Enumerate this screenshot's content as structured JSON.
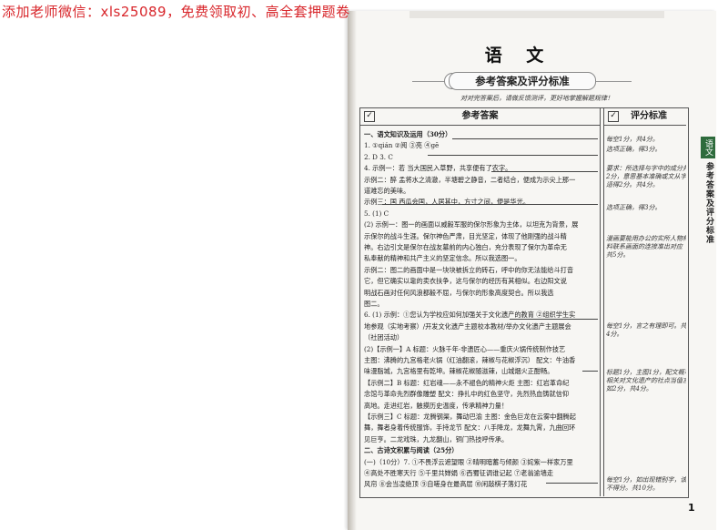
{
  "watermark": "添加老师微信：xls25089，免费领取初、高全套押题卷",
  "top_strip": "",
  "subject": "语 文",
  "banner_title": "参考答案及评分标准",
  "instruction": "对对完答案后，请做反馈测评，更好地掌握解题规律！",
  "header": {
    "answers": "参考答案",
    "standards": "评分标准"
  },
  "answer_lines": [
    {
      "text": "一、语文知识及运用（30分）",
      "bold": true
    },
    {
      "text": "1. ①qián ②阅 ③亮 ④gē"
    },
    {
      "text": "2. D 3. C"
    },
    {
      "text": "4. 示例一：若 当大国民入草野，共享便有了农字。"
    },
    {
      "text": "示例二：醉 孟将水之清澈，半塘碧之静音，二者结合，便成为示尖上那一"
    },
    {
      "text": "道难忘的美味。"
    },
    {
      "text": "示例三：国 西瓜会国，人居其中，方寸之间，便是华光。"
    },
    {
      "text": "5. (1) C"
    },
    {
      "text": "(2) 示例一：图一的画面以威毅军服的保尔形象为主体，以坦克为背景，展"
    },
    {
      "text": "示保尔的战斗生涯。保尔神色严肃，目光坚定，体现了他刚强的战斗精"
    },
    {
      "text": "神。右边引文是保尔在战友墓前的内心独白，充分表现了保尔为革命无"
    },
    {
      "text": "私奉献的精神和共产主义的坚定信念。所以我选图一。"
    },
    {
      "text": "示例二：图二的画面中是一块块被拆立的砖石，呼中的你无法能给斗打音"
    },
    {
      "text": "它，但它确实以靠的卖衣扶争，这与保尔的经历有其相似。右边阳文说"
    },
    {
      "text": "明战石画对任何风浪都毅不屈，与保尔的形象高度契合。所以我选"
    },
    {
      "text": "图二。"
    },
    {
      "text": "6. (1) 示例：①您认为学校应如何加强关于文化遗产的教育 ②组织学生实"
    },
    {
      "text": "地参观（实地考察）/开发文化遗产主题校本教材/举办文化遗产主题展会"
    },
    {
      "text": "（社团活动）"
    },
    {
      "text": "(2)【示例一】A 标题：火脉千年·非遗匠心——重庆火锅传统制作技艺"
    },
    {
      "text": "主图：沸腾的九宫格老火锅（红油翻滚，辣椒与花椒浮沉） 配文：牛油香"
    },
    {
      "text": "味漫脂城，九宫格里有乾坤。辣椒花椒随滋辣，山城烟火正酣畅。"
    },
    {
      "text": "【示例二】B 标题：红岩魂——永不褪色的精神火炬 主图：红岩革命纪"
    },
    {
      "text": "念馆与革命先烈群像雕塑 配文：挣扎中的红色坚守，先烈热血铸就信仰"
    },
    {
      "text": "高地。走进红岩，触摸历史温度，传承精神力量！"
    },
    {
      "text": "【示例三】C 标题：龙腾钢渠，舞动巴渝 主图：金色巨龙在云雾中翻腾起"
    },
    {
      "text": "舞，舞者身着传统服饰，手持龙节 配文：八手降龙，龙舞九霄，九曲回环"
    },
    {
      "text": "见巨亨。二龙戏珠，九龙翻山，铜门热技呼传承。"
    },
    {
      "text": "二、古诗文积累与阅读（25分）",
      "bold": true
    },
    {
      "text": "(一)（10分）7. ①不畏浮云遮望眼 ②晴明暗蓄与倾颜 ③姹紫一样家万里"
    },
    {
      "text": "④高处不胜寒天行 ⑤千里共婵娟 ⑥西蜀征调谁记起 ⑦老翁逾墙走"
    },
    {
      "text": "风帘 ⑧会当凌绝顶 ⑨自嗟身在最高层 ⑩闲敲棋子落灯花"
    }
  ],
  "standard_notes": [
    "每空1分，共4分。",
    "选项正确，得3分。",
    "要求：所选择与字中的成分并且",
    "2分，意思基本准确或文从字顺",
    "适得2分。共4分。",
    "选项正确，得3分。",
    "漫画要能用办公的实所人物材",
    "料联系画面的连接准出对应",
    "共5分。",
    "每空1分，言之有理即可。共",
    "4分。",
    "标题1分，主图1分，配文概率",
    "相关对文化遗产的社点当值言简",
    "如2分，共4分。",
    "每空1分，如出现错别字，该空",
    "不得分。共10分。"
  ],
  "side_tab": "语文",
  "side_text": "参考答案及评分标准",
  "page_number": "1"
}
